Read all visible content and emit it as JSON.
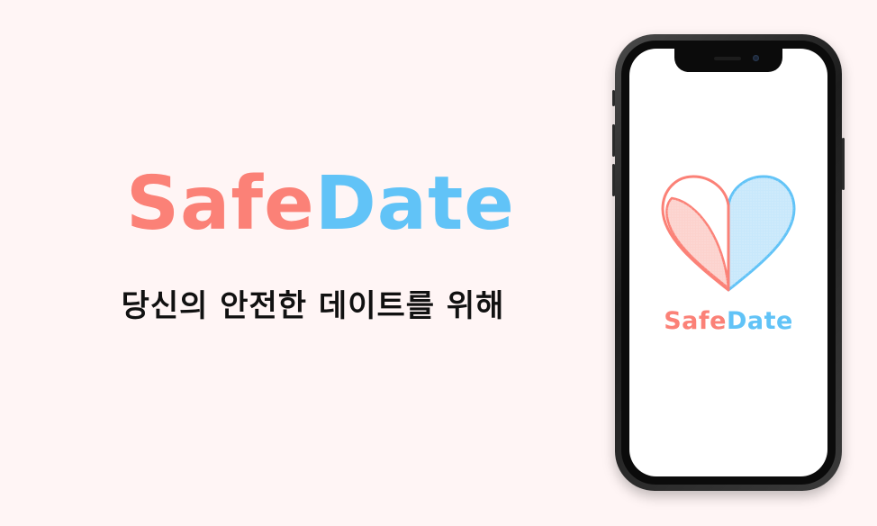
{
  "hero": {
    "title_part1": "Safe",
    "title_part2": "Date",
    "tagline": "당신의 안전한 데이트를 위해"
  },
  "phone_screen": {
    "app_name_part1": "Safe",
    "app_name_part2": "Date",
    "logo_icon": "heart-logo-icon"
  },
  "colors": {
    "background": "#fff5f5",
    "brand_pink": "#fb8177",
    "brand_blue": "#61c3f7",
    "heart_pink_fill": "#fcd2cd",
    "heart_blue_fill": "#c8e8fb"
  }
}
